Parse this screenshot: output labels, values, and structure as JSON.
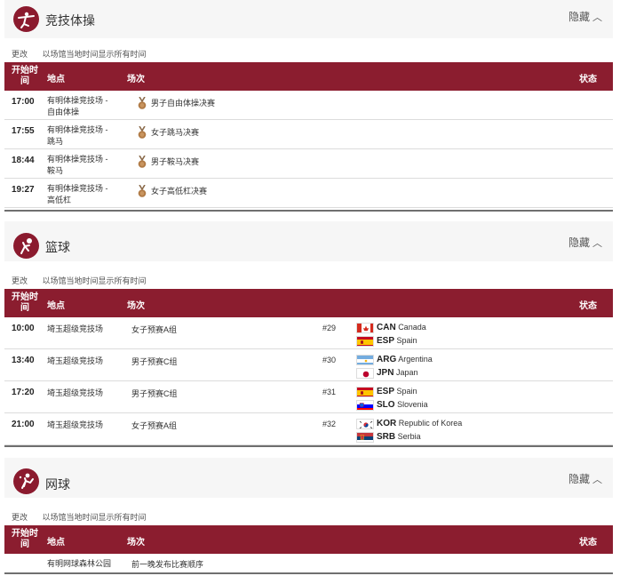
{
  "common": {
    "change_label": "更改",
    "tz_note": "以场馆当地时间显示所有时间",
    "hide_label": "隐藏",
    "col_time": "开始时间",
    "col_time_line1": "开始时",
    "col_time_line2": "间",
    "col_venue": "地点",
    "col_event": "场次",
    "col_status": "状态"
  },
  "gymnastics": {
    "name": "竞技体操",
    "icon": "gymnastics-icon",
    "rows": [
      {
        "time": "17:00",
        "venue_l1": "有明体操竞技场 -",
        "venue_l2": "自由体操",
        "event": "男子自由体操决赛"
      },
      {
        "time": "17:55",
        "venue_l1": "有明体操竞技场 -",
        "venue_l2": "跳马",
        "event": "女子跳马决赛"
      },
      {
        "time": "18:44",
        "venue_l1": "有明体操竞技场 -",
        "venue_l2": "鞍马",
        "event": "男子鞍马决赛"
      },
      {
        "time": "19:27",
        "venue_l1": "有明体操竞技场 -",
        "venue_l2": "高低杠",
        "event": "女子高低杠决赛"
      }
    ]
  },
  "basketball": {
    "name": "篮球",
    "icon": "basketball-icon",
    "rows": [
      {
        "time": "10:00",
        "venue": "埼玉超级竞技场",
        "event": "女子预赛A组",
        "game": "#29",
        "team1": {
          "code": "CAN",
          "name": "Canada",
          "flag": "canada"
        },
        "team2": {
          "code": "ESP",
          "name": "Spain",
          "flag": "spain"
        }
      },
      {
        "time": "13:40",
        "venue": "埼玉超级竞技场",
        "event": "男子预赛C组",
        "game": "#30",
        "team1": {
          "code": "ARG",
          "name": "Argentina",
          "flag": "argentina"
        },
        "team2": {
          "code": "JPN",
          "name": "Japan",
          "flag": "japan"
        }
      },
      {
        "time": "17:20",
        "venue": "埼玉超级竞技场",
        "event": "男子预赛C组",
        "game": "#31",
        "team1": {
          "code": "ESP",
          "name": "Spain",
          "flag": "spain"
        },
        "team2": {
          "code": "SLO",
          "name": "Slovenia",
          "flag": "slovenia"
        }
      },
      {
        "time": "21:00",
        "venue": "埼玉超级竞技场",
        "event": "女子预赛A组",
        "game": "#32",
        "team1": {
          "code": "KOR",
          "name": "Republic of Korea",
          "flag": "korea"
        },
        "team2": {
          "code": "SRB",
          "name": "Serbia",
          "flag": "serbia"
        }
      }
    ]
  },
  "tennis": {
    "name": "网球",
    "icon": "tennis-icon",
    "rows": [
      {
        "time": "",
        "venue": "有明网球森林公园",
        "event": "前一晚发布比赛顺序"
      }
    ]
  },
  "colors": {
    "header_red": "#8b1d2f",
    "icon_red": "#8b1a2e",
    "medal_bronze": "#b07a45"
  }
}
